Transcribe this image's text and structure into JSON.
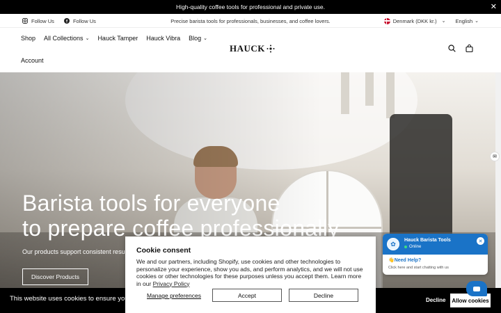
{
  "announcement": {
    "text": "High-quality coffee tools for professional and private use."
  },
  "utility": {
    "social": [
      {
        "icon": "instagram-icon",
        "label": "Follow Us"
      },
      {
        "icon": "facebook-icon",
        "label": "Follow Us"
      }
    ],
    "tagline": "Precise barista tools for professionals, businesses, and coffee lovers.",
    "country": "Denmark (DKK kr.)",
    "language": "English"
  },
  "nav": {
    "items": [
      {
        "label": "Shop",
        "dropdown": false
      },
      {
        "label": "All Collections",
        "dropdown": true
      },
      {
        "label": "Hauck Tamper",
        "dropdown": false
      },
      {
        "label": "Hauck Vibra",
        "dropdown": false
      },
      {
        "label": "Blog",
        "dropdown": true
      }
    ],
    "account": "Account",
    "logo": "HAUCK"
  },
  "hero": {
    "title_line1": "Barista tools for everyone",
    "title_line2": "to prepare coffee professionally",
    "subtitle": "Our products support consistent results",
    "cta": "Discover Products"
  },
  "consent": {
    "title": "Cookie consent",
    "body": "We and our partners, including Shopify, use cookies and other technologies to personalize your experience, show you ads, and perform analytics, and we will not use cookies or other technologies for these purposes unless you accept them. Learn more in our ",
    "policy_link": "Privacy Policy",
    "manage": "Manage preferences",
    "accept": "Accept",
    "decline": "Decline"
  },
  "cookiebar": {
    "message": "This website uses cookies to ensure you get",
    "decline": "Decline",
    "allow": "Allow cookies"
  },
  "chat": {
    "name": "Hauck Barista Tools",
    "status": "Online",
    "help": "👋Need Help?",
    "hint": "Click here and start chatting with us"
  },
  "colors": {
    "announce_bg": "#000000",
    "chat_accent": "#1a73c7",
    "online": "#3ddc84"
  }
}
